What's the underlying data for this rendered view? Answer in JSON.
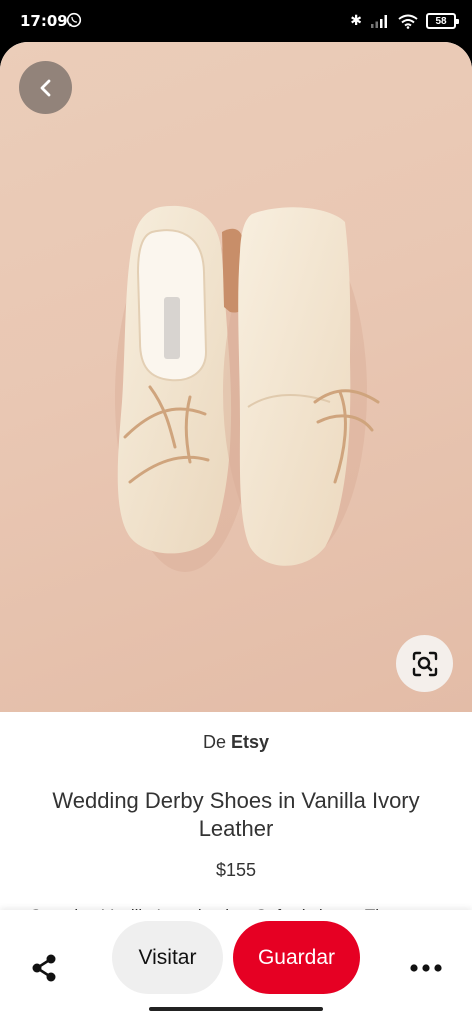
{
  "status_bar": {
    "time": "17:09",
    "battery_level": "58",
    "icons": [
      "whatsapp-icon",
      "bluetooth-icon",
      "signal-icon",
      "wifi-icon",
      "battery-icon"
    ]
  },
  "pin": {
    "back_icon": "chevron-left-icon",
    "visual_search_icon": "visual-search-icon",
    "source_prefix": "De",
    "source_name": "Etsy",
    "title": "Wedding Derby Shoes in Vanilla Ivory Leather",
    "price": "$155",
    "description": "Stunning Vanilla Ivory leather Oxford shoes. They"
  },
  "actions": {
    "share_icon": "share-icon",
    "visit_label": "Visitar",
    "save_label": "Guardar",
    "more_icon": "more-icon"
  },
  "colors": {
    "save_button": "#e60023",
    "visit_button": "#efefef",
    "image_background": "#e9c7b3"
  }
}
